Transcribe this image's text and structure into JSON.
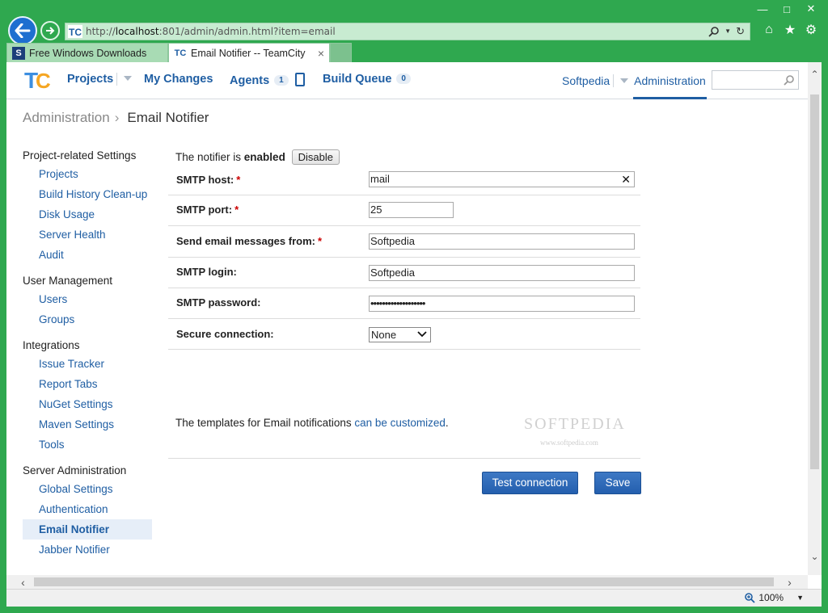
{
  "browser": {
    "url_prefix": "http://",
    "url_host": "localhost",
    "url_rest": ":801/admin/admin.html?item=email",
    "tabs": [
      {
        "label": "Free Windows Downloads",
        "icon": "softpedia-icon",
        "active": false
      },
      {
        "label": "Email Notifier -- TeamCity",
        "icon": "teamcity-icon",
        "active": true
      }
    ],
    "tab_close": "×",
    "zoom": "100%"
  },
  "header": {
    "logo": "TC",
    "projects": "Projects",
    "my_changes": "My Changes",
    "agents": "Agents",
    "agents_count": "1",
    "build_queue": "Build Queue",
    "build_queue_count": "0",
    "user": "Softpedia",
    "administration": "Administration",
    "search_placeholder": ""
  },
  "breadcrumb": {
    "parent": "Administration",
    "separator": "›",
    "current": "Email Notifier"
  },
  "sidebar": {
    "groups": [
      {
        "title": "Project-related Settings",
        "items": [
          "Projects",
          "Build History Clean-up",
          "Disk Usage",
          "Server Health",
          "Audit"
        ]
      },
      {
        "title": "User Management",
        "items": [
          "Users",
          "Groups"
        ]
      },
      {
        "title": "Integrations",
        "items": [
          "Issue Tracker",
          "Report Tabs",
          "NuGet Settings",
          "Maven Settings",
          "Tools"
        ]
      },
      {
        "title": "Server Administration",
        "items": [
          "Global Settings",
          "Authentication",
          "Email Notifier",
          "Jabber Notifier"
        ]
      }
    ],
    "selected": "Email Notifier"
  },
  "form": {
    "status_prefix": "The notifier is ",
    "status_value": "enabled",
    "disable_label": "Disable",
    "smtp_host_label": "SMTP host:",
    "smtp_host_value": "mail",
    "smtp_port_label": "SMTP port:",
    "smtp_port_value": "25",
    "from_label": "Send email messages from:",
    "from_value": "Softpedia",
    "login_label": "SMTP login:",
    "login_value": "Softpedia",
    "password_label": "SMTP password:",
    "password_value": "•••••••••••••••••••",
    "secure_label": "Secure connection:",
    "secure_value": "None",
    "required_mark": "*",
    "templates_text": "The templates for Email notifications ",
    "templates_link": "can be customized",
    "templates_end": ".",
    "test_connection_label": "Test connection",
    "save_label": "Save"
  },
  "watermark": {
    "text": "SOFTPEDIA",
    "sub": "www.softpedia.com"
  },
  "colors": {
    "accent": "#1f5ea3",
    "chrome": "#2fa84f",
    "selected_bg": "#e6eef8",
    "required": "#cc0000"
  }
}
